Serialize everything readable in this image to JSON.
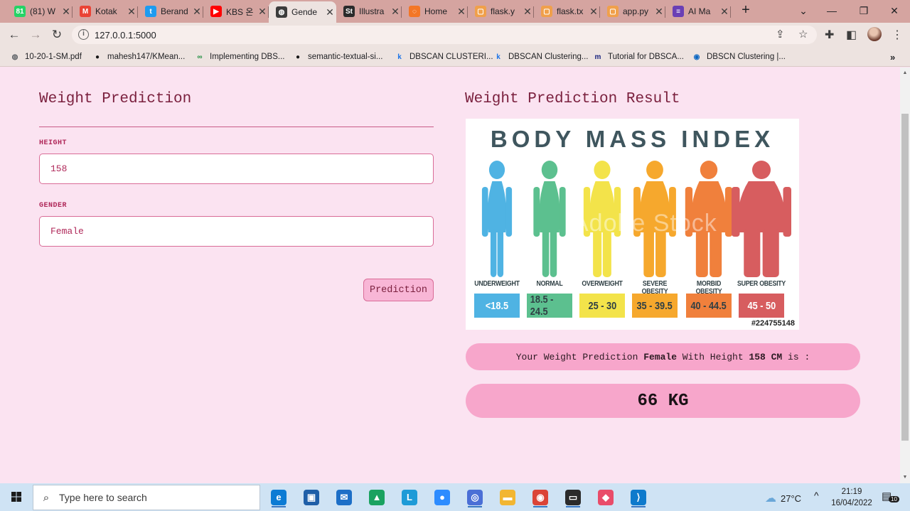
{
  "browser": {
    "tabs": [
      {
        "title": "(81) W",
        "favicon": "whatsapp-icon",
        "color": "#25d366",
        "glyph": "81"
      },
      {
        "title": "Kotak",
        "favicon": "gmail-icon",
        "color": "#ea4335",
        "glyph": "M"
      },
      {
        "title": "Berand",
        "favicon": "twitter-icon",
        "color": "#1d9bf0",
        "glyph": "t"
      },
      {
        "title": "KBS 온",
        "favicon": "youtube-icon",
        "color": "#ff0000",
        "glyph": "▶"
      },
      {
        "title": "Gende",
        "favicon": "globe-icon",
        "color": "#3c3c3c",
        "glyph": "◍",
        "active": true
      },
      {
        "title": "Illustra",
        "favicon": "adobe-stock-icon",
        "color": "#2b2b2b",
        "glyph": "St"
      },
      {
        "title": "Home",
        "favicon": "jupyter-icon",
        "color": "#f37626",
        "glyph": "◌"
      },
      {
        "title": "flask.y",
        "favicon": "file-icon",
        "color": "#f0a04b",
        "glyph": "▢"
      },
      {
        "title": "flask.tx",
        "favicon": "file-icon",
        "color": "#f0a04b",
        "glyph": "▢"
      },
      {
        "title": "app.py",
        "favicon": "file-icon",
        "color": "#f0a04b",
        "glyph": "▢"
      },
      {
        "title": "AI Ma",
        "favicon": "form-icon",
        "color": "#6a3fb5",
        "glyph": "≡"
      }
    ],
    "url": "127.0.0.1:5000",
    "bookmarks": [
      {
        "label": "10-20-1-SM.pdf",
        "icon": "globe-icon",
        "color": "#5f6368",
        "glyph": "◍"
      },
      {
        "label": "mahesh147/KMean...",
        "icon": "github-icon",
        "color": "#181717",
        "glyph": "●"
      },
      {
        "label": "Implementing DBS...",
        "icon": "link-icon",
        "color": "#1e8e3e",
        "glyph": "∞"
      },
      {
        "label": "semantic-textual-si...",
        "icon": "github-icon",
        "color": "#181717",
        "glyph": "●"
      },
      {
        "label": "DBSCAN CLUSTERI...",
        "icon": "k-icon",
        "color": "#1a73e8",
        "glyph": "k"
      },
      {
        "label": "DBSCAN Clustering...",
        "icon": "k-icon",
        "color": "#1a73e8",
        "glyph": "k"
      },
      {
        "label": "Tutorial for DBSCA...",
        "icon": "m-icon",
        "color": "#1a237e",
        "glyph": "m"
      },
      {
        "label": "DBSCN Clustering |...",
        "icon": "edge-icon",
        "color": "#0a66c2",
        "glyph": "◉"
      }
    ]
  },
  "form": {
    "title": "Weight Prediction",
    "height_label": "HEIGHT",
    "height_value": "158",
    "gender_label": "GENDER",
    "gender_value": "Female",
    "button_label": "Prediction"
  },
  "result": {
    "title": "Weight Prediction Result",
    "statement_prefix": "Your Weight Prediction ",
    "gender": "Female",
    "statement_middle": " With Height ",
    "height": "158 CM",
    "statement_suffix": " is :",
    "weight": "66 KG"
  },
  "bmi_image": {
    "heading": "BODY MASS INDEX",
    "watermark": "Adobe Stock",
    "stock_id": "#224755148",
    "categories": [
      {
        "label": "UNDERWEIGHT",
        "range": "<18.5",
        "color": "#4fb3e3"
      },
      {
        "label": "NORMAL",
        "range": "18.5 - 24.5",
        "color": "#5cc08f"
      },
      {
        "label": "OVERWEIGHT",
        "range": "25 - 30",
        "color": "#f3e34a"
      },
      {
        "label": "SEVERE OBESITY",
        "range": "35 - 39.5",
        "color": "#f6a82d"
      },
      {
        "label": "MORBID OBESITY",
        "range": "40 - 44.5",
        "color": "#f0803c"
      },
      {
        "label": "SUPER OBESITY",
        "range": "45 - 50",
        "color": "#d75d5f"
      }
    ]
  },
  "taskbar": {
    "search_placeholder": "Type here to search",
    "temperature": "27°C",
    "time": "21:19",
    "date": "16/04/2022",
    "notification_count": "10",
    "apps": [
      {
        "name": "edge-icon",
        "color": "#0c7bd4",
        "glyph": "e"
      },
      {
        "name": "store-icon",
        "color": "#1f5fa8",
        "glyph": "▣"
      },
      {
        "name": "mail-icon",
        "color": "#1d6fc7",
        "glyph": "✉"
      },
      {
        "name": "drive-icon",
        "color": "#1aa260",
        "glyph": "▲"
      },
      {
        "name": "l-app-icon",
        "color": "#1e9bd7",
        "glyph": "L"
      },
      {
        "name": "zoom-icon",
        "color": "#2d8cff",
        "glyph": "●"
      },
      {
        "name": "chromium-icon",
        "color": "#4b6fd6",
        "glyph": "◎"
      },
      {
        "name": "file-explorer-icon",
        "color": "#f2b632",
        "glyph": "▬"
      },
      {
        "name": "chrome-icon",
        "color": "#db4437",
        "glyph": "◉"
      },
      {
        "name": "terminal-icon",
        "color": "#2b2b2b",
        "glyph": "▭"
      },
      {
        "name": "git-kraken-icon",
        "color": "#e94c69",
        "glyph": "◆"
      },
      {
        "name": "vscode-icon",
        "color": "#0e7acc",
        "glyph": "⟩"
      }
    ]
  }
}
